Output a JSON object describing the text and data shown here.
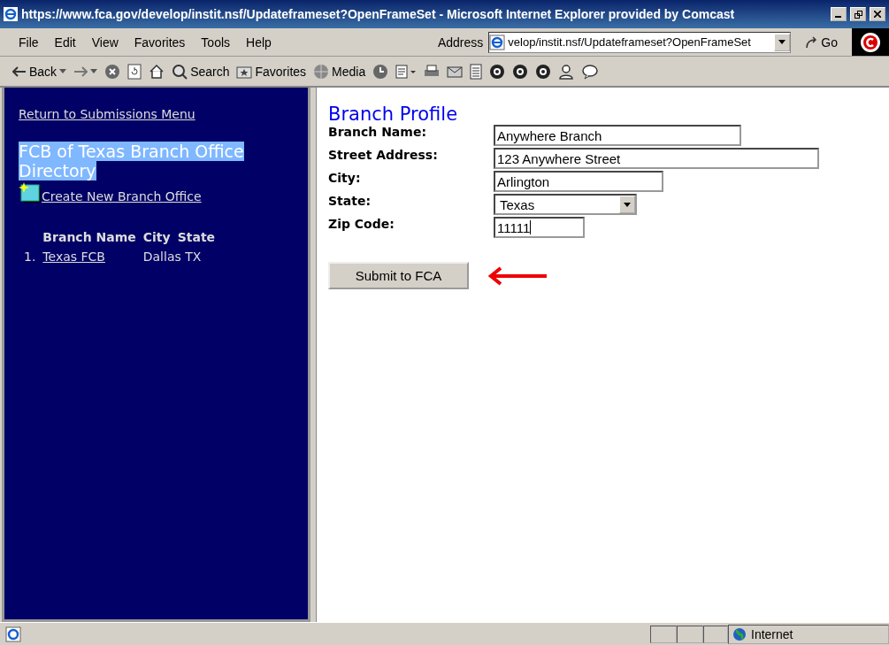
{
  "window": {
    "title": "https://www.fca.gov/develop/instit.nsf/Updateframeset?OpenFrameSet - Microsoft Internet Explorer provided by Comcast"
  },
  "menu": [
    "File",
    "Edit",
    "View",
    "Favorites",
    "Tools",
    "Help"
  ],
  "address": {
    "label": "Address",
    "value": "velop/instit.nsf/Updateframeset?OpenFrameSet",
    "go": "Go"
  },
  "toolbar": [
    {
      "kind": "back",
      "label": "Back"
    },
    {
      "kind": "forward"
    },
    {
      "kind": "stop"
    },
    {
      "kind": "refresh"
    },
    {
      "kind": "home"
    },
    {
      "kind": "search",
      "label": "Search"
    },
    {
      "kind": "favorites",
      "label": "Favorites"
    },
    {
      "kind": "media",
      "label": "Media"
    },
    {
      "kind": "history"
    },
    {
      "kind": "edit"
    },
    {
      "kind": "print"
    },
    {
      "kind": "mail"
    },
    {
      "kind": "doc"
    },
    {
      "kind": "circle"
    },
    {
      "kind": "circle"
    },
    {
      "kind": "circle"
    },
    {
      "kind": "person"
    },
    {
      "kind": "bubble"
    }
  ],
  "sidebar": {
    "return_link": "Return to Submissions Menu",
    "heading": "FCB of Texas Branch Office Directory",
    "heading_highlighted": true,
    "create_link": "Create New Branch Office",
    "columns": [
      "Branch Name",
      "City",
      "State"
    ],
    "rows": [
      {
        "number": "1.",
        "name": "Texas FCB",
        "location": "Dallas TX"
      }
    ]
  },
  "form": {
    "title": "Branch Profile",
    "fields": [
      {
        "kind": "text",
        "label": "Branch Name:",
        "value": "Anywhere Branch"
      },
      {
        "kind": "text",
        "label": "Street Address:",
        "value": "123 Anywhere Street"
      },
      {
        "kind": "text",
        "label": "City:",
        "value": "Arlington"
      },
      {
        "kind": "select",
        "label": "State:",
        "value": "Texas"
      },
      {
        "kind": "text",
        "label": "Zip Code:",
        "value": "11111",
        "focused": true
      }
    ],
    "submit": "Submit to FCA"
  },
  "status_bar": {
    "zone": "Internet"
  }
}
